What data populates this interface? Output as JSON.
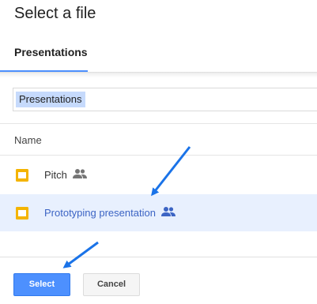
{
  "dialog": {
    "title": "Select a file"
  },
  "tabs": [
    {
      "label": "Presentations",
      "active": true
    }
  ],
  "breadcrumb": {
    "current": "Presentations"
  },
  "list": {
    "column_header": "Name",
    "items": [
      {
        "name": "Pitch",
        "icon": "slides-icon",
        "shared": true,
        "selected": false
      },
      {
        "name": "Prototyping presentation",
        "icon": "slides-icon",
        "shared": true,
        "selected": true
      }
    ]
  },
  "buttons": {
    "select": "Select",
    "cancel": "Cancel"
  },
  "colors": {
    "accent": "#4d90fe",
    "selected_row": "#e8f0fe",
    "slides_icon": "#f4b400",
    "annotation_arrow": "#1a73e8"
  }
}
